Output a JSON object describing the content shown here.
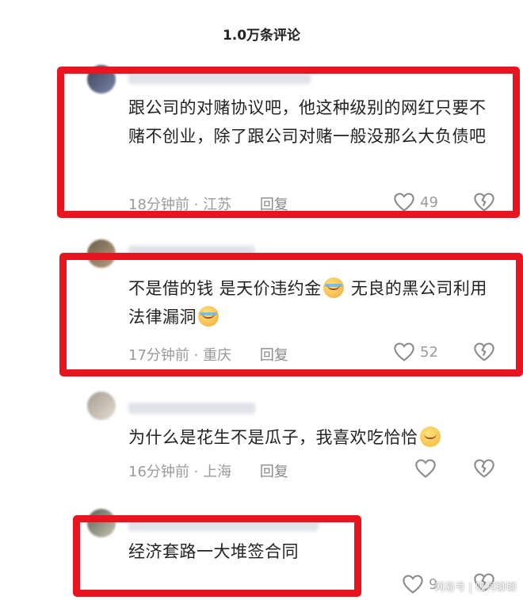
{
  "header": {
    "title": "1.0万条评论"
  },
  "comments": [
    {
      "text": "跟公司的对赌协议吧，他这种级别的网红只要不赌不创业，除了跟公司对赌一般没那么大负债吧",
      "time_location": "18分钟前 · 江苏",
      "reply": "回复",
      "likes": "49"
    },
    {
      "text_a": "不是借的钱 是天价违约金",
      "text_b": " 无良的黑公司利用法律漏洞",
      "time_location": "17分钟前 · 重庆",
      "reply": "回复",
      "likes": "52"
    },
    {
      "text": "为什么是花生不是瓜子，我喜欢吃恰恰",
      "time_location": "16分钟前 · 上海",
      "reply": "回复",
      "likes": ""
    },
    {
      "text": "经济套路一大堆签合同",
      "likes": "9"
    }
  ],
  "watermark": "网易号 | 吸柯聊聊",
  "colors": {
    "highlight": "#e8141f",
    "meta": "#9a9a9a"
  },
  "icons": {
    "like": "heart-icon",
    "dislike": "broken-heart-icon"
  }
}
